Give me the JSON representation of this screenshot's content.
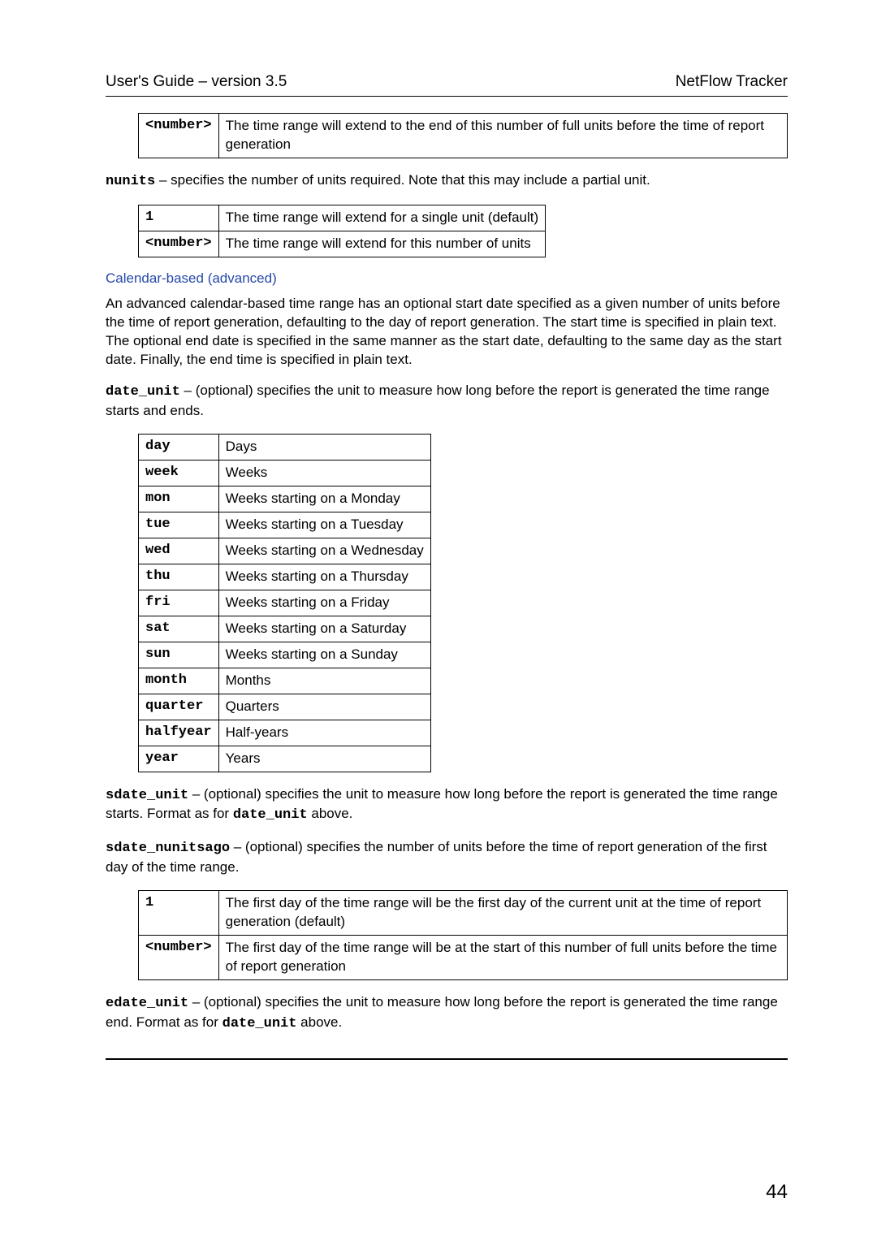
{
  "header": {
    "left": "User's Guide – version 3.5",
    "right": "NetFlow Tracker"
  },
  "table1": {
    "key": "<number>",
    "val": "The time range will extend to the end of this number of full units before the time of report generation"
  },
  "p_nunits_pre": "nunits",
  "p_nunits": " – specifies the number of units required. Note that this may include a partial unit.",
  "table2": {
    "r1k": "1",
    "r1v": "The time range will extend for a single unit (default)",
    "r2k": "<number>",
    "r2v": "The time range will extend for this number of units"
  },
  "sect_cal": "Calendar-based (advanced)",
  "p_cal": "An advanced calendar-based time range has an optional start date specified as a given number of units before the time of report generation, defaulting to the day of report generation. The start time is specified in plain text. The optional end date is specified in the same manner as the start date, defaulting to the same day as the start date. Finally, the end time is specified in plain text.",
  "p_dateunit_pre": "date_unit",
  "p_dateunit": " – (optional) specifies the unit to measure how long before the report is generated the time range starts and ends.",
  "units": [
    {
      "k": "day",
      "v": "Days"
    },
    {
      "k": "week",
      "v": "Weeks"
    },
    {
      "k": "mon",
      "v": "Weeks starting on a Monday"
    },
    {
      "k": "tue",
      "v": "Weeks starting on a Tuesday"
    },
    {
      "k": "wed",
      "v": "Weeks starting on a Wednesday"
    },
    {
      "k": "thu",
      "v": "Weeks starting on a Thursday"
    },
    {
      "k": "fri",
      "v": "Weeks starting on a Friday"
    },
    {
      "k": "sat",
      "v": "Weeks starting on a Saturday"
    },
    {
      "k": "sun",
      "v": "Weeks starting on a Sunday"
    },
    {
      "k": "month",
      "v": "Months"
    },
    {
      "k": "quarter",
      "v": "Quarters"
    },
    {
      "k": "halfyear",
      "v": "Half-years"
    },
    {
      "k": "year",
      "v": "Years"
    }
  ],
  "p_sdateunit_pre": "sdate_unit",
  "p_sdateunit_mid": " – (optional) specifies the unit to measure how long before the report is generated the time range starts. Format as for ",
  "p_sdateunit_code": "date_unit",
  "p_sdateunit_end": " above.",
  "p_sdatenago_pre": "sdate_nunitsago",
  "p_sdatenago": " – (optional) specifies the number of units before the time of report generation of the first day of the time range.",
  "table4": {
    "r1k": "1",
    "r1v": "The first day of the time range will be the first day of the current unit at the time of report generation (default)",
    "r2k": "<number>",
    "r2v": "The first day of the time range will be at the start of this number of full units before the time of report generation"
  },
  "p_edateunit_pre": "edate_unit",
  "p_edateunit_mid": " – (optional) specifies the unit to measure how long before the report is generated the time range end. Format as for ",
  "p_edateunit_code": "date_unit",
  "p_edateunit_end": " above.",
  "page": "44"
}
